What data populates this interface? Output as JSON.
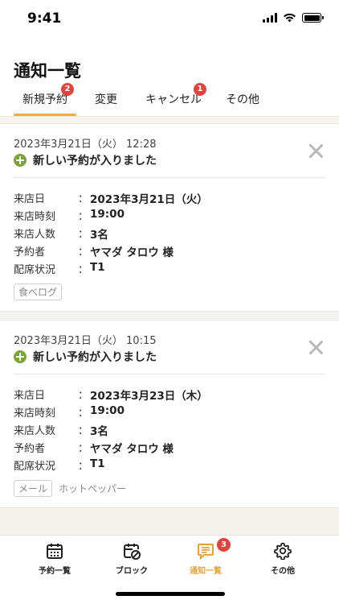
{
  "status": {
    "time": "9:41"
  },
  "header": {
    "title": "通知一覧"
  },
  "tabs": [
    {
      "label": "新規予約",
      "badge": "2"
    },
    {
      "label": "変更",
      "badge": ""
    },
    {
      "label": "キャンセル",
      "badge": "1"
    },
    {
      "label": "その他",
      "badge": ""
    }
  ],
  "notifications": [
    {
      "datetime": "2023年3月21日（火） 12:28",
      "headline": "新しい予約が入りました",
      "details": [
        {
          "label": "来店日",
          "value": "2023年3月21日（火）"
        },
        {
          "label": "来店時刻",
          "value": "19:00"
        },
        {
          "label": "来店人数",
          "value": "3名"
        },
        {
          "label": "予約者",
          "value": "ヤマダ タロウ 様"
        },
        {
          "label": "配席状況",
          "value": "T1"
        }
      ],
      "source_tag": "食べログ",
      "source_extra": ""
    },
    {
      "datetime": "2023年3月21日（火） 10:15",
      "headline": "新しい予約が入りました",
      "details": [
        {
          "label": "来店日",
          "value": "2023年3月23日（木）"
        },
        {
          "label": "来店時刻",
          "value": "19:00"
        },
        {
          "label": "来店人数",
          "value": "3名"
        },
        {
          "label": "予約者",
          "value": "ヤマダ タロウ 様"
        },
        {
          "label": "配席状況",
          "value": "T1"
        }
      ],
      "source_tag": "メール",
      "source_extra": "ホットペッパー"
    }
  ],
  "colon": "：",
  "bottom_nav": [
    {
      "label": "予約一覧",
      "icon": "calendar-icon",
      "badge": ""
    },
    {
      "label": "ブロック",
      "icon": "calendar-block-icon",
      "badge": ""
    },
    {
      "label": "通知一覧",
      "icon": "chat-icon",
      "badge": "3"
    },
    {
      "label": "その他",
      "icon": "gear-icon",
      "badge": ""
    }
  ],
  "colors": {
    "accent": "#f1b03c",
    "badge": "#e0443e",
    "success": "#79a832",
    "background": "#f6f3ee"
  }
}
